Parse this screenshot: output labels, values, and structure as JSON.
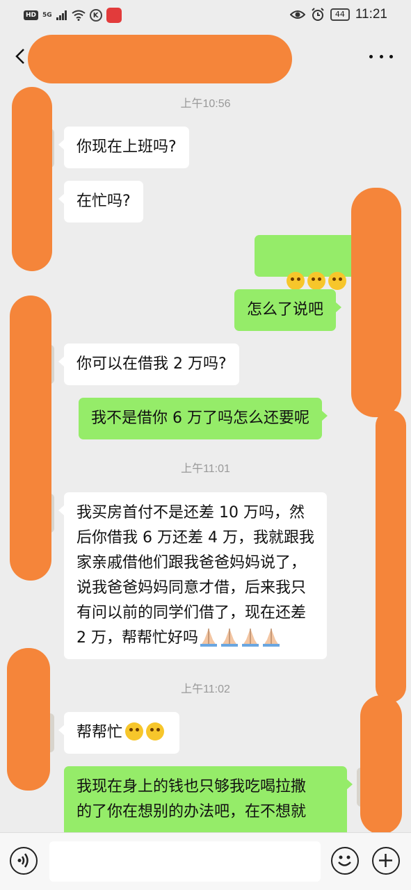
{
  "status_bar": {
    "hd": "HD",
    "network": "5G",
    "battery": "44",
    "time": "11:21"
  },
  "chat": {
    "timestamps": [
      "上午10:56",
      "上午11:01",
      "上午11:02"
    ],
    "messages": [
      {
        "side": "in",
        "text": "你现在上班吗?"
      },
      {
        "side": "in",
        "text": "在忙吗?"
      },
      {
        "side": "out",
        "text": "",
        "emoji": "dizzy-face-emoji ×3"
      },
      {
        "side": "out",
        "text": "怎么了说吧"
      },
      {
        "side": "in",
        "text": "你可以在借我 2 万吗?"
      },
      {
        "side": "out",
        "text": "我不是借你 6 万了吗怎么还要呢"
      },
      {
        "side": "in",
        "text": "我买房首付不是还差 10 万吗，然\n后你借我 6 万还差 4 万，我就跟我\n家亲戚借他们跟我爸爸妈妈说了，\n说我爸爸妈妈同意才借，后来我只\n有问以前的同学们借了，现在还差\n2 万，帮帮忙好吗",
        "emoji": "folded-hands-emoji ×4"
      },
      {
        "side": "in",
        "text": "帮帮忙",
        "emoji": "crying-face-emoji ×2"
      },
      {
        "side": "out",
        "text": "我现在身上的钱也只够我吃喝拉撒\n的了你在想别的办法吧，在不想就"
      }
    ]
  },
  "input_bar": {
    "placeholder": ""
  },
  "colors": {
    "background": "#ededed",
    "bubble_out": "#95ec69",
    "bubble_in": "#ffffff",
    "timestamp": "#999999",
    "redaction": "#f5853a"
  }
}
